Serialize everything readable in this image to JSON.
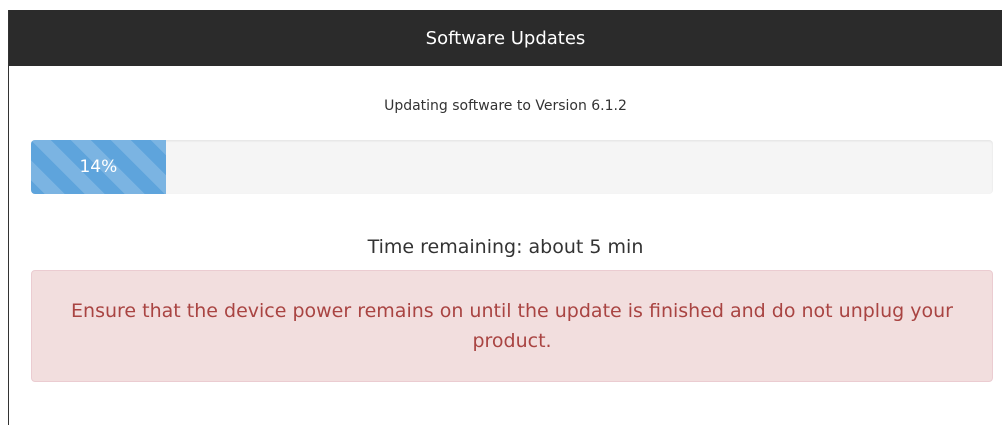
{
  "dialog": {
    "title": "Software Updates"
  },
  "update": {
    "subtitle": "Updating software to Version 6.1.2",
    "progress_value": 14,
    "progress_label": "14%",
    "time_remaining": "Time remaining: about 5 min",
    "warning": "Ensure that the device power remains on until the update is finished and do not unplug your product."
  },
  "colors": {
    "titlebar": "#2b2b2b",
    "progress_fill": "#5ea4dc",
    "alert_background": "#f2dede",
    "alert_text": "#a94442"
  }
}
